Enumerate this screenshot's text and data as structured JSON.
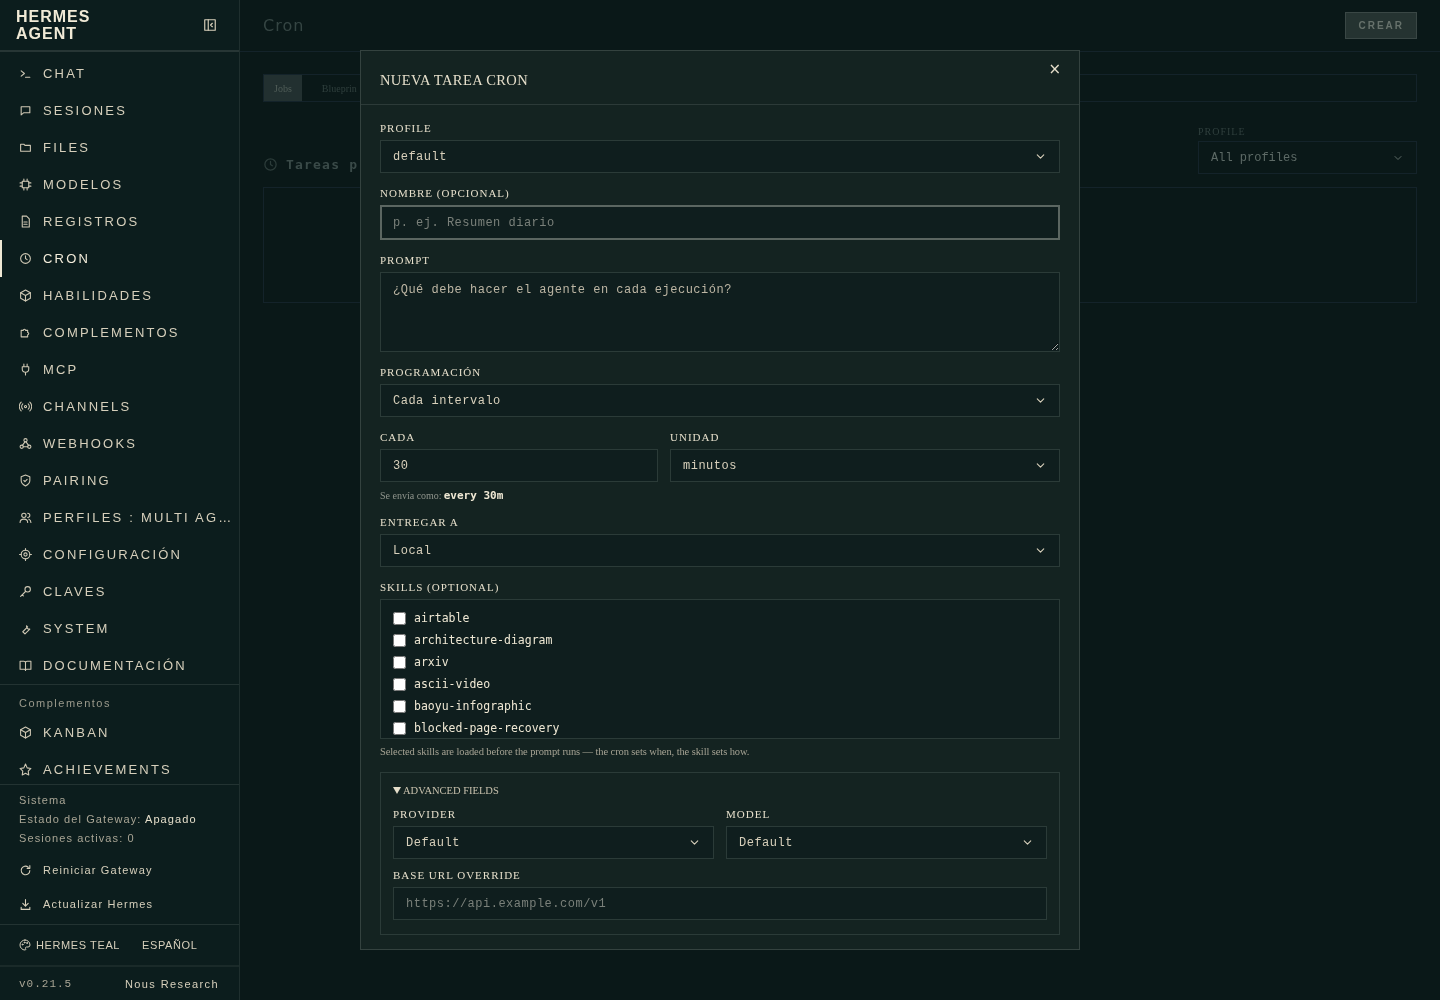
{
  "sidebar": {
    "brand": "HERMES AGENT",
    "items": [
      {
        "label": "CHAT",
        "selected": false
      },
      {
        "label": "SESIONES",
        "selected": false
      },
      {
        "label": "FILES",
        "selected": false
      },
      {
        "label": "MODELOS",
        "selected": false
      },
      {
        "label": "REGISTROS",
        "selected": false
      },
      {
        "label": "CRON",
        "selected": true
      },
      {
        "label": "HABILIDADES",
        "selected": false
      },
      {
        "label": "COMPLEMENTOS",
        "selected": false
      },
      {
        "label": "MCP",
        "selected": false
      },
      {
        "label": "CHANNELS",
        "selected": false
      },
      {
        "label": "WEBHOOKS",
        "selected": false
      },
      {
        "label": "PAIRING",
        "selected": false
      },
      {
        "label": "PERFILES : MULTI AG…",
        "selected": false
      },
      {
        "label": "CONFIGURACIÓN",
        "selected": false
      },
      {
        "label": "CLAVES",
        "selected": false
      },
      {
        "label": "SYSTEM",
        "selected": false
      },
      {
        "label": "DOCUMENTACIÓN",
        "selected": false
      }
    ],
    "plugins_heading": "Complementos",
    "plugins": [
      {
        "label": "KANBAN",
        "selected": false
      },
      {
        "label": "ACHIEVEMENTS",
        "selected": false
      }
    ],
    "system": {
      "heading": "Sistema",
      "gateway_label": "Estado del Gateway:",
      "gateway_status": "Apagado",
      "sessions": "Sesiones activas: 0"
    },
    "actions": [
      "Reiniciar Gateway",
      "Actualizar Hermes"
    ],
    "theme": "HERMES TEAL",
    "language": "ESPAÑOL",
    "version": "v0.21.5",
    "credit": "Nous Research"
  },
  "page": {
    "title": "Cron",
    "create_button": "CREAR",
    "tabs": [
      {
        "label": "Jobs",
        "selected": true
      },
      {
        "label": "Blueprin",
        "selected": false
      }
    ],
    "section_title": "Tareas p",
    "profile_filter": {
      "label": "PROFILE",
      "value": "All profiles"
    }
  },
  "modal": {
    "title": "NUEVA TAREA CRON",
    "close": "×",
    "fields": [
      {
        "kind": "select",
        "label": "PROFILE",
        "value": "default"
      },
      {
        "kind": "input",
        "label": "NOMBRE (OPCIONAL)",
        "placeholder": "p. ej. Resumen diario",
        "focused": true
      },
      {
        "kind": "textarea",
        "label": "PROMPT",
        "placeholder": "¿Qué debe hacer el agente en cada ejecución?"
      },
      {
        "kind": "select",
        "label": "PROGRAMACIÓN",
        "value": "Cada intervalo"
      },
      {
        "kind": "row",
        "fields": [
          {
            "kind": "input",
            "label": "CADA",
            "value": "30",
            "focused": false
          },
          {
            "kind": "select",
            "label": "UNIDAD",
            "value": "minutos"
          }
        ]
      },
      {
        "kind": "hint",
        "text": "Se envía como:",
        "code": "every 30m"
      },
      {
        "kind": "select",
        "label": "ENTREGAR A",
        "value": "Local"
      },
      {
        "kind": "checklist",
        "label": "SKILLS (OPTIONAL)",
        "items": [
          {
            "label": "airtable",
            "checked": false
          },
          {
            "label": "architecture-diagram",
            "checked": false
          },
          {
            "label": "arxiv",
            "checked": false
          },
          {
            "label": "ascii-video",
            "checked": false
          },
          {
            "label": "baoyu-infographic",
            "checked": false
          },
          {
            "label": "blocked-page-recovery",
            "checked": false
          }
        ]
      },
      {
        "kind": "note",
        "text": "Selected skills are loaded before the prompt runs — the cron sets when, the skill sets how."
      },
      {
        "kind": "details",
        "summary": "ADVANCED FIELDS",
        "expanded": true,
        "fields": [
          {
            "kind": "row",
            "fields": [
              {
                "kind": "select",
                "label": "PROVIDER",
                "value": "Default"
              },
              {
                "kind": "select",
                "label": "MODEL",
                "value": "Default"
              }
            ]
          },
          {
            "kind": "input",
            "label": "BASE URL OVERRIDE",
            "placeholder": "https://api.example.com/v1",
            "focused": false
          }
        ]
      }
    ]
  }
}
